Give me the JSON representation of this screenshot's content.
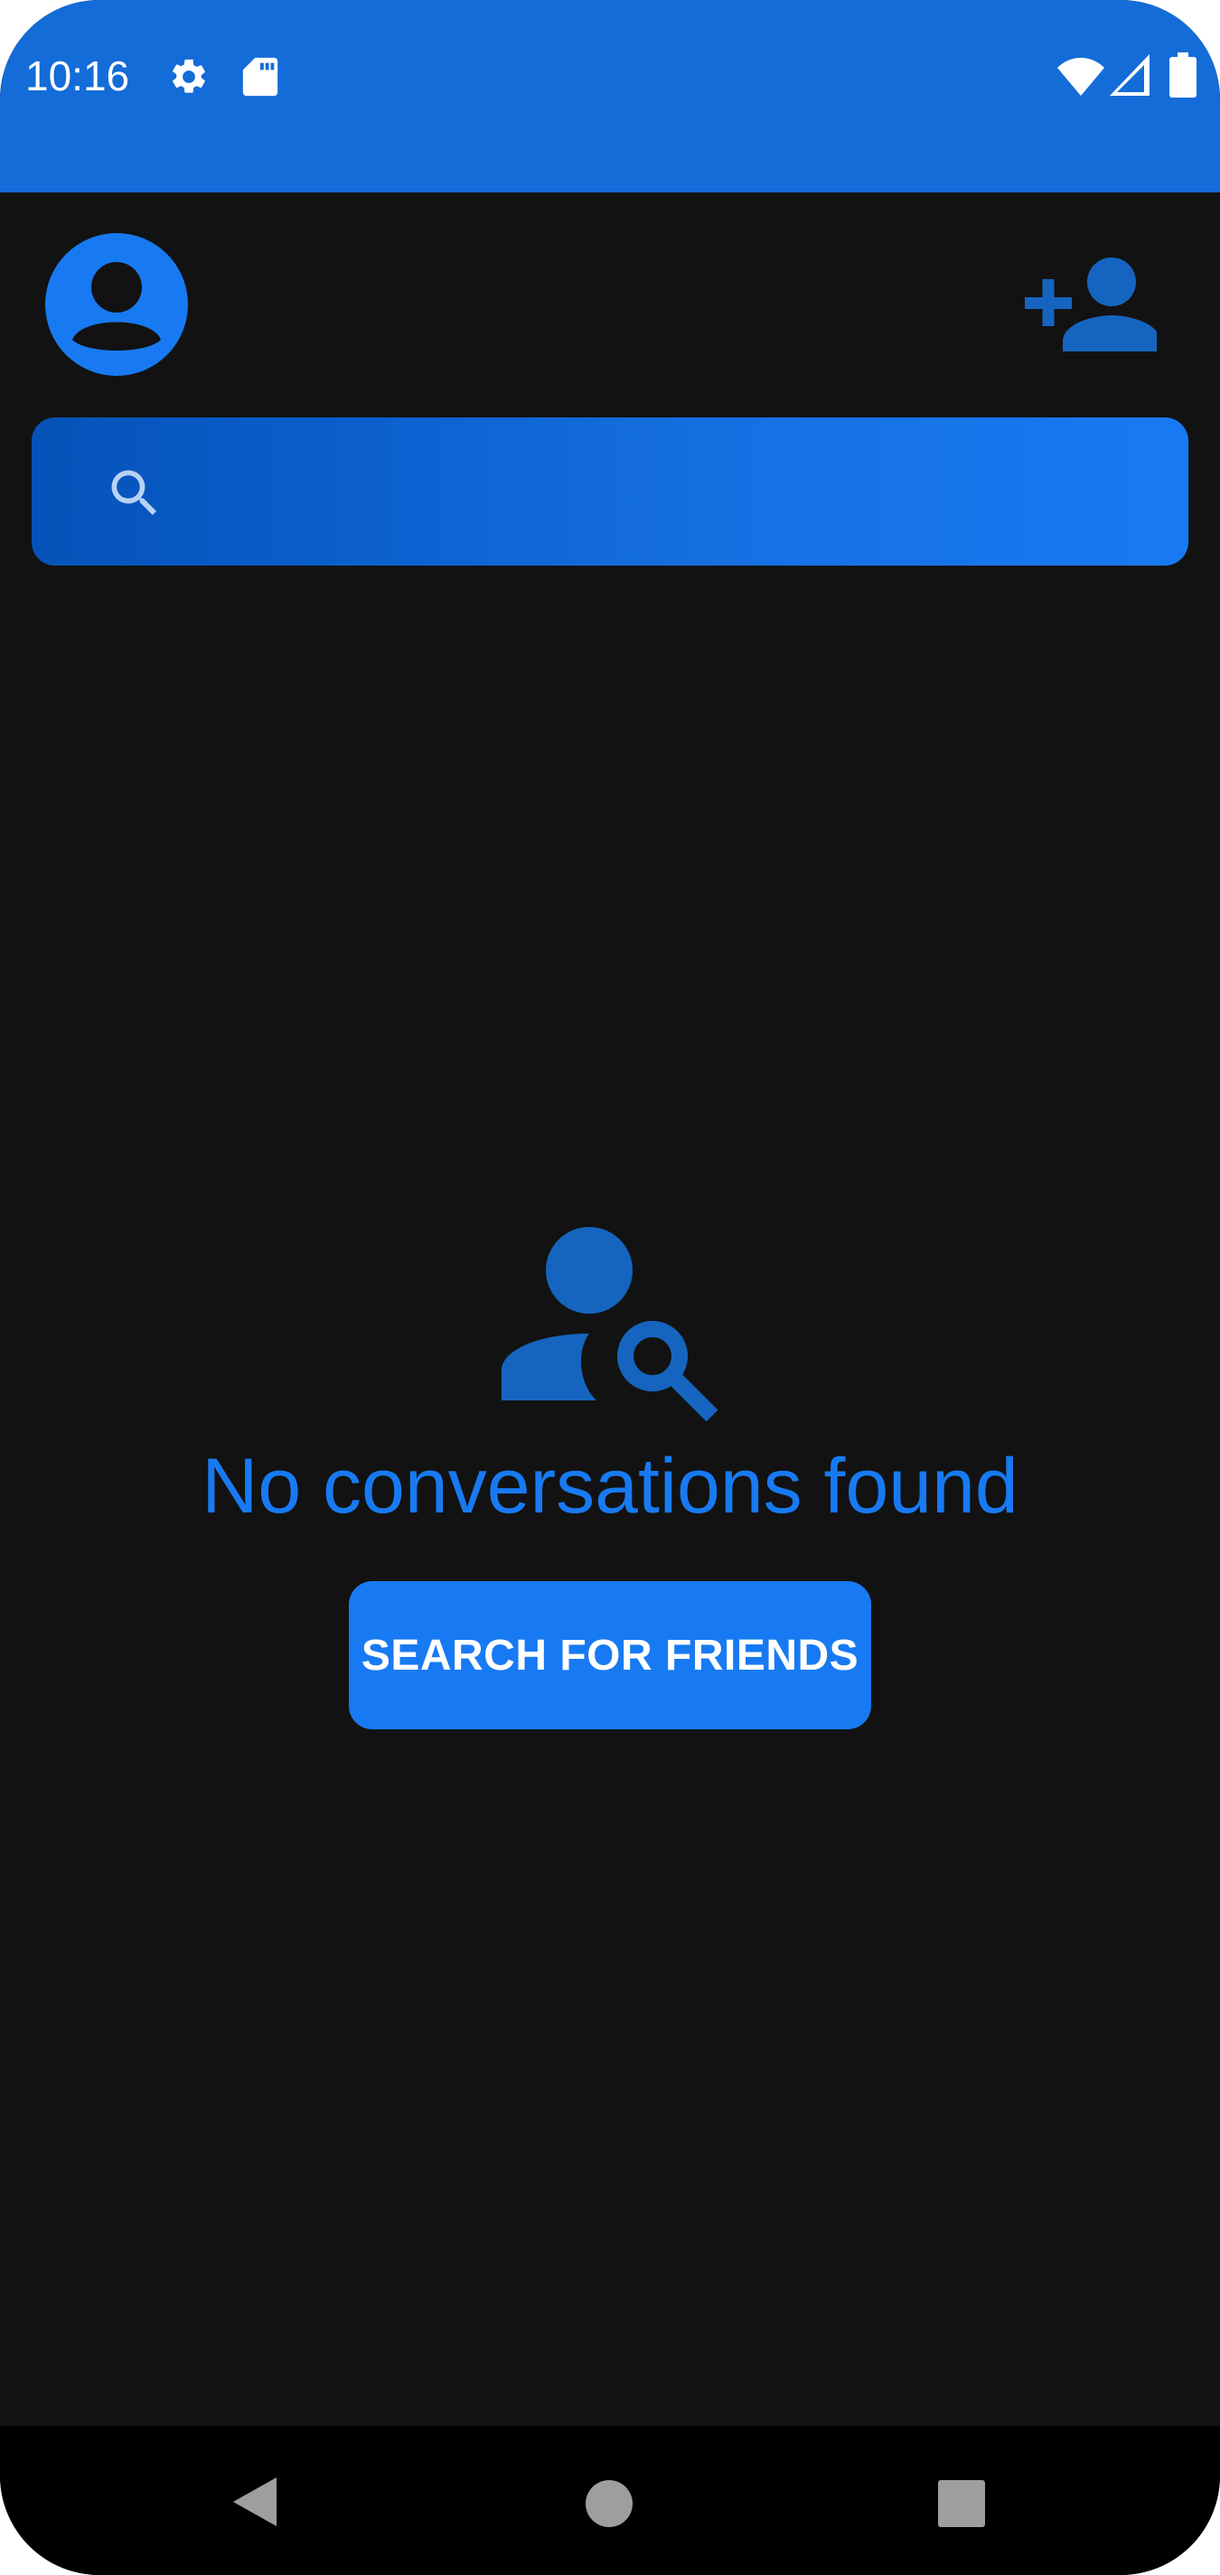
{
  "status_bar": {
    "time": "10:16",
    "icons": [
      "settings-gear-icon",
      "sd-card-icon",
      "wifi-icon",
      "cellular-signal-icon",
      "battery-icon"
    ]
  },
  "header": {
    "avatar_icon": "account-circle-icon",
    "add_friend_icon": "person-add-icon"
  },
  "search": {
    "placeholder": "",
    "value": "",
    "icon": "search-icon"
  },
  "empty_state": {
    "icon": "person-search-icon",
    "message": "No conversations found",
    "button_label": "SEARCH FOR FRIENDS"
  },
  "nav_bar": {
    "buttons": [
      "back-icon",
      "home-icon",
      "recents-icon"
    ]
  },
  "colors": {
    "status_bar": "#136CD8",
    "background": "#121212",
    "accent": "#187AF2",
    "accent_dark": "#1565C0",
    "nav_bar": "#000000"
  }
}
